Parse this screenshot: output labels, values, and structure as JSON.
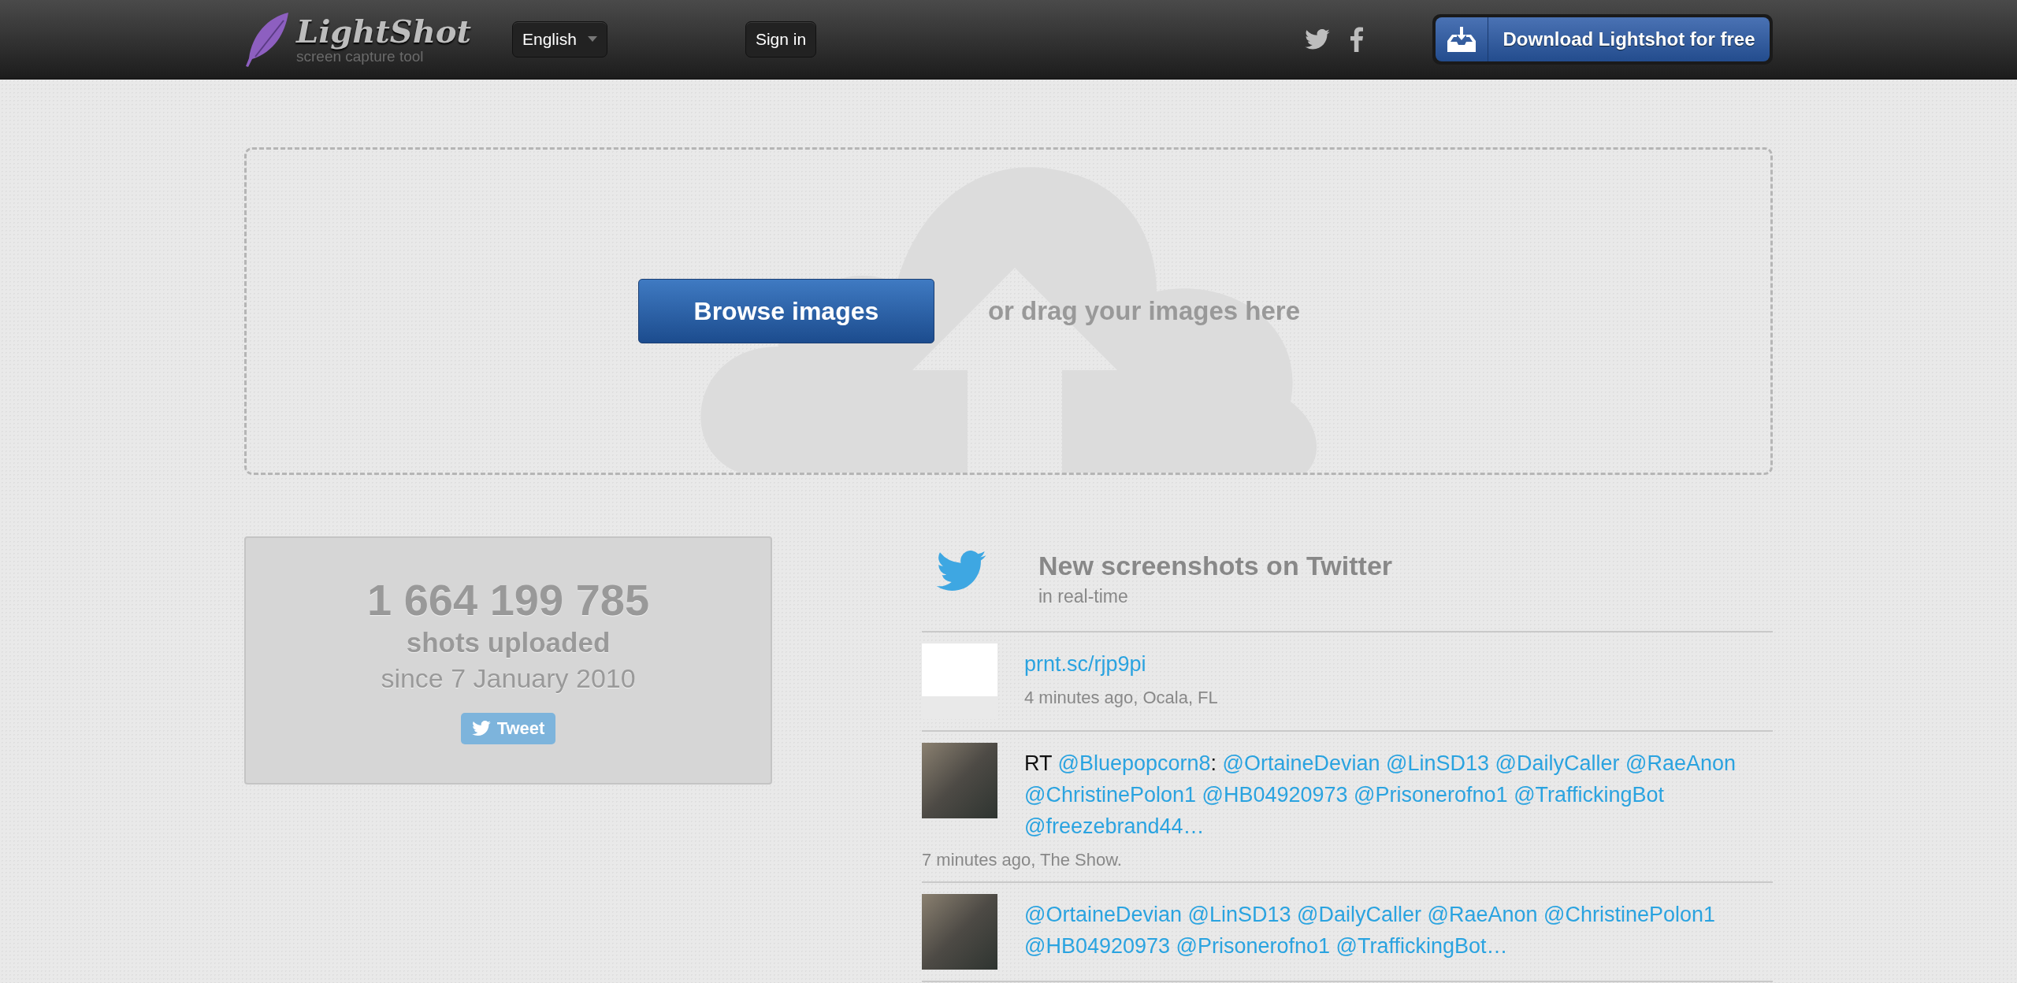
{
  "header": {
    "logo": {
      "name": "LightShot",
      "tagline": "screen capture tool"
    },
    "language": "English",
    "sign_in": "Sign in",
    "download": "Download Lightshot for free"
  },
  "upload": {
    "button": "Browse images",
    "hint": "or drag your images here"
  },
  "stats": {
    "count": "1 664 199 785",
    "label": "shots uploaded",
    "since": "since 7 January 2010",
    "tweet_button": "Tweet"
  },
  "twitter": {
    "title": "New screenshots on Twitter",
    "subtitle": "in real-time",
    "tweets": [
      {
        "kind": "logo",
        "segments": [
          {
            "kind": "link",
            "text": "prnt.sc/rjp9pi"
          }
        ],
        "meta": "4 minutes ago, Ocala, FL"
      },
      {
        "kind": "photo",
        "segments": [
          {
            "kind": "plain",
            "text": "RT "
          },
          {
            "kind": "link",
            "text": "@Bluepopcorn8"
          },
          {
            "kind": "plain",
            "text": ": "
          },
          {
            "kind": "link",
            "text": "@OrtaineDevian"
          },
          {
            "kind": "link",
            "text": "@LinSD13"
          },
          {
            "kind": "link",
            "text": "@DailyCaller"
          },
          {
            "kind": "link",
            "text": "@RaeAnon"
          },
          {
            "kind": "link",
            "text": "@ChristinePolon1"
          },
          {
            "kind": "link",
            "text": "@HB04920973"
          },
          {
            "kind": "link",
            "text": "@Prisonerofno1"
          },
          {
            "kind": "link",
            "text": "@TraffickingBot"
          },
          {
            "kind": "link",
            "text": "@freezebrand44…"
          }
        ],
        "meta": "7 minutes ago, The Show."
      },
      {
        "kind": "photo",
        "segments": [
          {
            "kind": "link",
            "text": "@OrtaineDevian"
          },
          {
            "kind": "link",
            "text": "@LinSD13"
          },
          {
            "kind": "link",
            "text": "@DailyCaller"
          },
          {
            "kind": "link",
            "text": "@RaeAnon"
          },
          {
            "kind": "link",
            "text": "@ChristinePolon1"
          },
          {
            "kind": "link",
            "text": "@HB04920973"
          },
          {
            "kind": "link",
            "text": "@Prisonerofno1"
          },
          {
            "kind": "link",
            "text": "@TraffickingBot…"
          }
        ]
      }
    ]
  }
}
